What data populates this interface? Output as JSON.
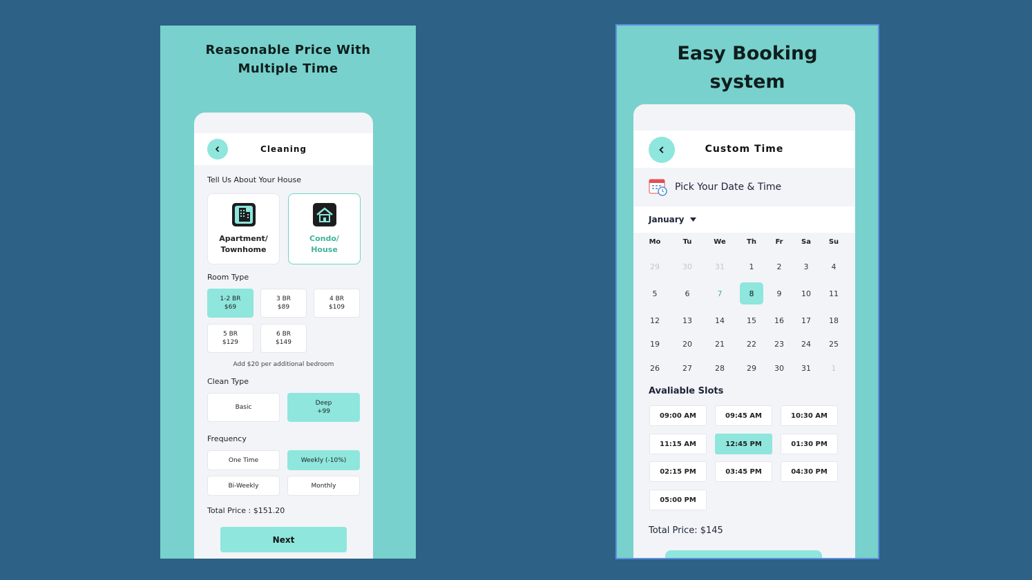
{
  "left": {
    "title_line1": "Reasonable Price With",
    "title_line2": "Multiple Time",
    "appbar_title": "Cleaning",
    "house_label": "Tell Us About Your House",
    "house_types": [
      {
        "line1": "Apartment/",
        "line2": "Townhome",
        "icon": "building-icon"
      },
      {
        "line1": "Condo/",
        "line2": "House",
        "icon": "house-icon"
      }
    ],
    "room_label": "Room Type",
    "rooms": [
      {
        "line1": "1-2 BR",
        "line2": "$69"
      },
      {
        "line1": "3 BR",
        "line2": "$89"
      },
      {
        "line1": "4 BR",
        "line2": "$109"
      },
      {
        "line1": "5 BR",
        "line2": "$129"
      },
      {
        "line1": "6 BR",
        "line2": "$149"
      }
    ],
    "room_note": "Add $20 per additional bedroom",
    "clean_label": "Clean Type",
    "clean_types": [
      {
        "line1": "Basic",
        "line2": ""
      },
      {
        "line1": "Deep",
        "line2": "+99"
      }
    ],
    "frequency_label": "Frequency",
    "frequencies": [
      "One Time",
      "Weekly (-10%)",
      "Bi-Weekly",
      "Monthly"
    ],
    "total": "Total Price : $151.20",
    "next_label": "Next"
  },
  "right": {
    "title_line1": "Easy Booking",
    "title_line2": "system",
    "appbar_title": "Custom Time",
    "pick_label": "Pick Your Date & Time",
    "month": "January",
    "weekdays": [
      "Mo",
      "Tu",
      "We",
      "Th",
      "Fr",
      "Sa",
      "Su"
    ],
    "days": [
      [
        "29",
        "30",
        "31",
        "1",
        "2",
        "3",
        "4"
      ],
      [
        "5",
        "6",
        "7",
        "8",
        "9",
        "10",
        "11"
      ],
      [
        "12",
        "13",
        "14",
        "15",
        "16",
        "17",
        "18"
      ],
      [
        "19",
        "20",
        "21",
        "22",
        "23",
        "24",
        "25"
      ],
      [
        "26",
        "27",
        "28",
        "29",
        "30",
        "31",
        "1"
      ]
    ],
    "slots_label": "Avaliable Slots",
    "slots": [
      "09:00 AM",
      "09:45 AM",
      "10:30 AM",
      "11:15 AM",
      "12:45 PM",
      "01:30 PM",
      "02:15 PM",
      "03:45 PM",
      "04:30 PM",
      "05:00 PM"
    ],
    "total": "Total Price: $145"
  },
  "colors": {
    "background": "#2e6186",
    "panel": "#78d1cc",
    "accent": "#8ee6dd",
    "selected_text": "#3fb19a"
  }
}
